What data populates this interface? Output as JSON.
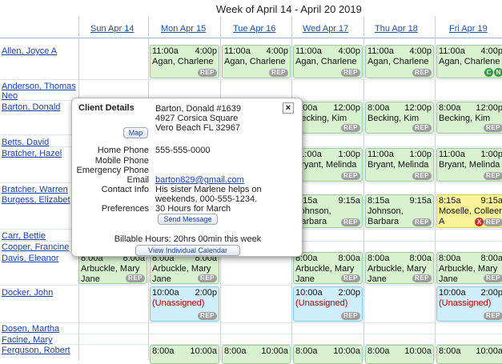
{
  "week_title": "Week of April 14 - April 20 2019",
  "days": [
    "Sun Apr 14",
    "Mon Apr 15",
    "Tue Apr 16",
    "Wed Apr 17",
    "Thu Apr 18",
    "Fri Apr 19"
  ],
  "clients": {
    "allen": "Allen, Joyce A",
    "anderson1": "Anderson, Thomas",
    "anderson2": "Neo",
    "barton": "Barton, Donald",
    "betts": "Betts, David",
    "bratcher_h": "Bratcher, Hazel",
    "bratcher_w": "Bratcher, Warren",
    "burgess": "Burgess, Elizabet",
    "carr": "Carr, Bettie",
    "cooper": "Cooper, Francine",
    "davis": "Davis, Eleanor",
    "docker": "Docker, John",
    "dosen": "Dosen, Martha",
    "facine": "Facine, Mary",
    "ferguson": "Ferguson, Robert"
  },
  "appointments": {
    "allen_mon": {
      "start": "11:00a",
      "end": "4:00p",
      "name": "Agan, Charlene",
      "badge": "REP"
    },
    "allen_tue": {
      "start": "11:00a",
      "end": "4:00p",
      "name": "Agan, Charlene",
      "badge": "REP"
    },
    "allen_wed": {
      "start": "11:00a",
      "end": "4:00p",
      "name": "Agan, Charlene",
      "badge": "REP"
    },
    "allen_thu": {
      "start": "11:00a",
      "end": "4:00p",
      "name": "Agan, Charlene",
      "badge": "REP"
    },
    "allen_fri": {
      "start": "11:00a",
      "end": "4:00p",
      "name": "Agan, Charlene",
      "badge": "REP",
      "icon1": "C",
      "icon2": "N"
    },
    "barton_wed": {
      "start": "8:00a",
      "end": "12:00p",
      "name": "Becking, Kim",
      "badge": "REP"
    },
    "barton_thu": {
      "start": "8:00a",
      "end": "12:00p",
      "name": "Becking, Kim",
      "badge": "REP"
    },
    "barton_fri": {
      "start": "8:00a",
      "end": "12:00p",
      "name": "Becking, Kim",
      "badge": "REP"
    },
    "bratcher_wed": {
      "start": "11:00a",
      "end": "1:00p",
      "name": "Bryant, Melinda",
      "badge": "REP"
    },
    "bratcher_thu": {
      "start": "11:00a",
      "end": "1:00p",
      "name": "Bryant, Melinda",
      "badge": "REP"
    },
    "bratcher_fri": {
      "start": "11:00a",
      "end": "1:00p",
      "name": "Bryant, Melinda",
      "badge": "REP"
    },
    "burgess_wed": {
      "start": "8:15a",
      "end": "9:15a",
      "name1": "Johnson,",
      "name2": "Barbara",
      "badge": "REP"
    },
    "burgess_thu": {
      "start": "8:15a",
      "end": "9:15a",
      "name1": "Johnson,",
      "name2": "Barbara",
      "badge": "REP"
    },
    "burgess_fri": {
      "start": "8:15a",
      "end": "9:15a",
      "name1": "Moselle, Colleen",
      "name2": "A",
      "badge": "REP",
      "icon": "X"
    },
    "davis_mon": {
      "start": "8:00a",
      "end": "8:00a",
      "name1": "Arbuckle, Mary",
      "name2": "Jane",
      "badge": "REP"
    },
    "davis_tue": {
      "start": "8:00a",
      "end": "8:00a",
      "name1": "Arbuckle, Mary",
      "name2": "Jane",
      "badge": "REP"
    },
    "davis_wed": {
      "start": "8:00a",
      "end": "8:00a",
      "name1": "Arbuckle, Mary",
      "name2": "Jane",
      "badge": "REP"
    },
    "davis_thu": {
      "start": "8:00a",
      "end": "8:00a",
      "name1": "Arbuckle, Mary",
      "name2": "Jane",
      "badge": "REP"
    },
    "davis_fri": {
      "start": "8:00a",
      "end": "8:00a",
      "name1": "Arbuckle, Mary",
      "name2": "Jane",
      "badge": "REP"
    },
    "docker_mon": {
      "start": "10:00a",
      "end": "2:00p",
      "name": "(Unassigned)",
      "badge": "REP"
    },
    "docker_wed": {
      "start": "10:00a",
      "end": "2:00p",
      "name": "(Unassigned)",
      "badge": "REP"
    },
    "docker_fri": {
      "start": "10:00a",
      "end": "2:00p",
      "name": "(Unassigned)",
      "badge": "REP"
    },
    "ferguson_mon": {
      "start": "8:00a",
      "end": "10:00a"
    },
    "ferguson_tue": {
      "start": "8:00a",
      "end": "10:00a"
    },
    "ferguson_wed": {
      "start": "8:00a",
      "end": "10:00a"
    },
    "ferguson_thu": {
      "start": "8:00a",
      "end": "10:00a"
    },
    "ferguson_fri": {
      "start": "8:00a",
      "end": "10:00a"
    }
  },
  "popup": {
    "title": "Client Details",
    "close": "×",
    "name_line": "Barton, Donald   #1639",
    "address1": "4927 Corsica Square",
    "address2": "Vero Beach FL 32967",
    "map_button": "Map",
    "home_phone_label": "Home Phone",
    "home_phone": "555-555-0000",
    "mobile_phone_label": "Mobile Phone",
    "emergency_phone_label": "Emergency Phone",
    "email_label": "Email",
    "email": "barton829@gmail.com",
    "contact_label": "Contact Info",
    "contact1": "His sister Marlene helps on",
    "contact2": "weekends, 000-555-1234.",
    "preferences_label": "Preferences",
    "preferences": "30 Hours for March",
    "send_message": "Send Message",
    "billable": "Billable Hours: 20hrs 00min this week",
    "view_calendar": "View Individual Calendar"
  }
}
